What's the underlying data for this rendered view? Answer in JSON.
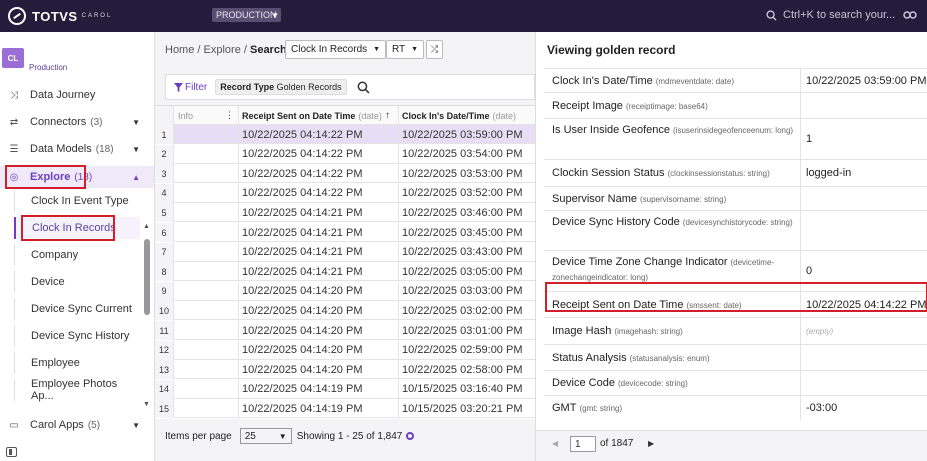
{
  "topbar": {
    "logo_text": "TOTVS",
    "logo_sub": "CAROL",
    "environment": "PRODUCTION",
    "search_placeholder": "Ctrl+K to search your..."
  },
  "sidebar": {
    "project_badge": "CL",
    "project_name": "Production",
    "items": [
      {
        "label": "Data Journey",
        "count": ""
      },
      {
        "label": "Connectors",
        "count": "(3)"
      },
      {
        "label": "Data Models",
        "count": "(18)"
      },
      {
        "label": "Explore",
        "count": "(18)"
      }
    ],
    "sub_items": [
      "Clock In Event Type",
      "Clock In Records",
      "Company",
      "Device",
      "Device Sync Current",
      "Device Sync History",
      "Employee",
      "Employee Photos Ap..."
    ],
    "carol_apps": {
      "label": "Carol Apps",
      "count": "(5)"
    }
  },
  "main": {
    "breadcrumb": {
      "home": "Home",
      "sep1": " / ",
      "explore": "Explore",
      "sep2": " / ",
      "current": "Search"
    },
    "model_select": "Clock In Records",
    "rt_select": "RT",
    "filter_label": "Filter",
    "filter_tag_key": "Record Type",
    "filter_tag_value": "Golden Records",
    "grid": {
      "headers": {
        "info": "Info",
        "col_a": "Receipt Sent on Date Time",
        "col_a_type": "(date)",
        "col_b": "Clock In's Date/Time",
        "col_b_type": "(date)"
      },
      "rows": [
        {
          "n": "1",
          "a": "10/22/2025 04:14:22 PM",
          "b": "10/22/2025 03:59:00 PM"
        },
        {
          "n": "2",
          "a": "10/22/2025 04:14:22 PM",
          "b": "10/22/2025 03:54:00 PM"
        },
        {
          "n": "3",
          "a": "10/22/2025 04:14:22 PM",
          "b": "10/22/2025 03:53:00 PM"
        },
        {
          "n": "4",
          "a": "10/22/2025 04:14:22 PM",
          "b": "10/22/2025 03:52:00 PM"
        },
        {
          "n": "5",
          "a": "10/22/2025 04:14:21 PM",
          "b": "10/22/2025 03:46:00 PM"
        },
        {
          "n": "6",
          "a": "10/22/2025 04:14:21 PM",
          "b": "10/22/2025 03:45:00 PM"
        },
        {
          "n": "7",
          "a": "10/22/2025 04:14:21 PM",
          "b": "10/22/2025 03:43:00 PM"
        },
        {
          "n": "8",
          "a": "10/22/2025 04:14:21 PM",
          "b": "10/22/2025 03:05:00 PM"
        },
        {
          "n": "9",
          "a": "10/22/2025 04:14:20 PM",
          "b": "10/22/2025 03:03:00 PM"
        },
        {
          "n": "10",
          "a": "10/22/2025 04:14:20 PM",
          "b": "10/22/2025 03:02:00 PM"
        },
        {
          "n": "11",
          "a": "10/22/2025 04:14:20 PM",
          "b": "10/22/2025 03:01:00 PM"
        },
        {
          "n": "12",
          "a": "10/22/2025 04:14:20 PM",
          "b": "10/22/2025 02:59:00 PM"
        },
        {
          "n": "13",
          "a": "10/22/2025 04:14:20 PM",
          "b": "10/22/2025 02:58:00 PM"
        },
        {
          "n": "14",
          "a": "10/22/2025 04:14:19 PM",
          "b": "10/15/2025 03:16:40 PM"
        },
        {
          "n": "15",
          "a": "10/22/2025 04:14:19 PM",
          "b": "10/15/2025 03:20:21 PM"
        }
      ]
    },
    "pager": {
      "items_per_page_label": "Items per page",
      "items_per_page": "25",
      "showing": "Showing 1 - 25 of 1,847"
    }
  },
  "record_panel": {
    "title": "Viewing golden record",
    "fields": [
      {
        "label": "Clock In's Date/Time",
        "field": "(mdmeventdate: date)",
        "value": "10/22/2025 03:59:00 PM"
      },
      {
        "label": "Receipt Image",
        "field": "(receiptimage: base64)",
        "value": ""
      },
      {
        "label": "Is User Inside Geofence",
        "field": "(isuserinsidegeofenceenum: long)",
        "value": "1"
      },
      {
        "label": "Clockin Session Status",
        "field": "(clockinsessionstatus: string)",
        "value": "logged-in"
      },
      {
        "label": "Supervisor Name",
        "field": "(supervisorname: string)",
        "value": ""
      },
      {
        "label": "Device Sync History Code",
        "field": "(devicesynchistorycode: string)",
        "value": ""
      },
      {
        "label": "Device Time Zone Change Indicator",
        "field": "(devicetime-zonechangeindicator: long)",
        "value": "0"
      },
      {
        "label": "Receipt Sent on Date Time",
        "field": "(smssent: date)",
        "value": "10/22/2025 04:14:22 PM"
      },
      {
        "label": "Image Hash",
        "field": "(imagehash: string)",
        "value": "(empty)"
      },
      {
        "label": "Status Analysis",
        "field": "(statusanalysis: enum)",
        "value": ""
      },
      {
        "label": "Device Code",
        "field": "(devicecode: string)",
        "value": ""
      },
      {
        "label": "GMT",
        "field": "(gmt: string)",
        "value": "-03:00"
      }
    ],
    "footer": {
      "page": "1",
      "of": "of 1847"
    }
  },
  "colors": {
    "topbar": "#251c3c",
    "accent": "#6b3fc0",
    "highlight": "#d21f2a"
  }
}
